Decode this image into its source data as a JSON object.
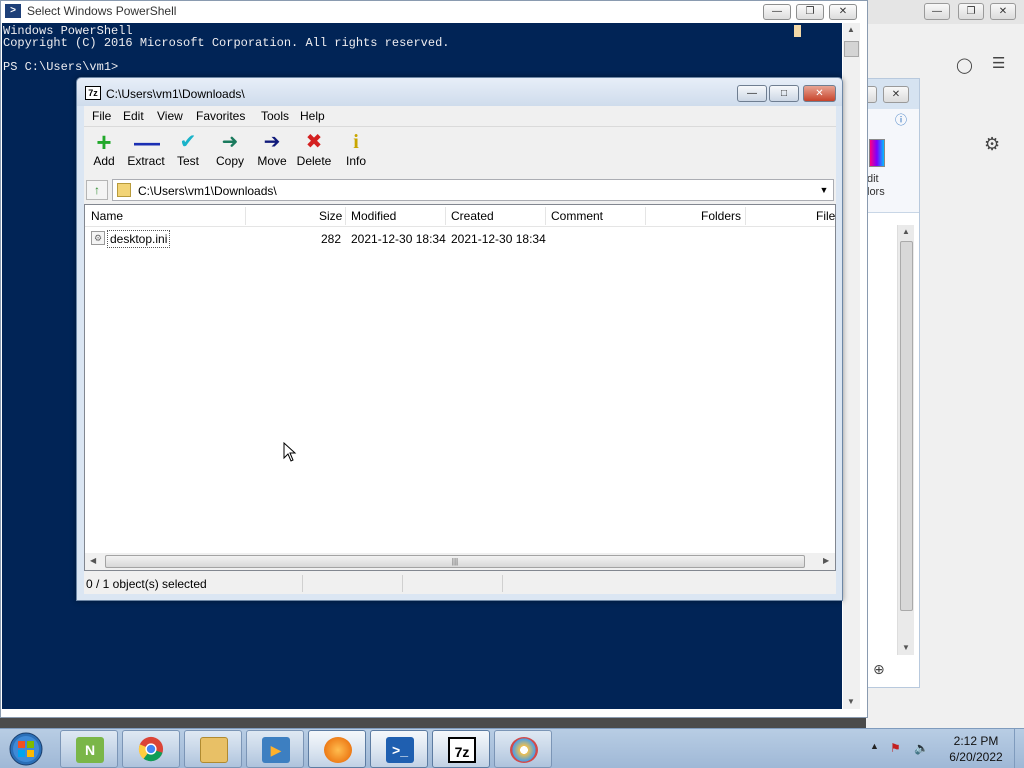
{
  "powershell": {
    "title": "Select Windows PowerShell",
    "console_lines": [
      "Windows PowerShell",
      "Copyright (C) 2016 Microsoft Corporation. All rights reserved.",
      "",
      "PS C:\\Users\\vm1>"
    ]
  },
  "zip": {
    "title": "C:\\Users\\vm1\\Downloads\\",
    "title_icon": "7z",
    "menu": [
      "File",
      "Edit",
      "View",
      "Favorites",
      "Tools",
      "Help"
    ],
    "toolbar": {
      "add": "Add",
      "extract": "Extract",
      "test": "Test",
      "copy": "Copy",
      "move": "Move",
      "delete": "Delete",
      "info": "Info"
    },
    "path": "C:\\Users\\vm1\\Downloads\\",
    "columns": {
      "name": "Name",
      "size": "Size",
      "modified": "Modified",
      "created": "Created",
      "comment": "Comment",
      "folders": "Folders",
      "files": "File"
    },
    "rows": [
      {
        "name": "desktop.ini",
        "size": "282",
        "modified": "2021-12-30 18:34",
        "created": "2021-12-30 18:34",
        "comment": "",
        "folders": "",
        "files": ""
      }
    ],
    "status": "0 / 1 object(s) selected"
  },
  "bg_paint": {
    "ribbon_text_1": "dit",
    "ribbon_text_2": "lors"
  },
  "taskbar": {
    "apps": [
      "notepad++",
      "chrome",
      "file-explorer",
      "media-player",
      "firefox",
      "powershell",
      "7-zip",
      "paint"
    ],
    "seven_zip_label": "7z",
    "time": "2:12 PM",
    "date": "6/20/2022"
  },
  "colors": {
    "console_bg": "#012456",
    "console_fg": "#eeedf0",
    "taskbar": "#9fb8d6"
  }
}
